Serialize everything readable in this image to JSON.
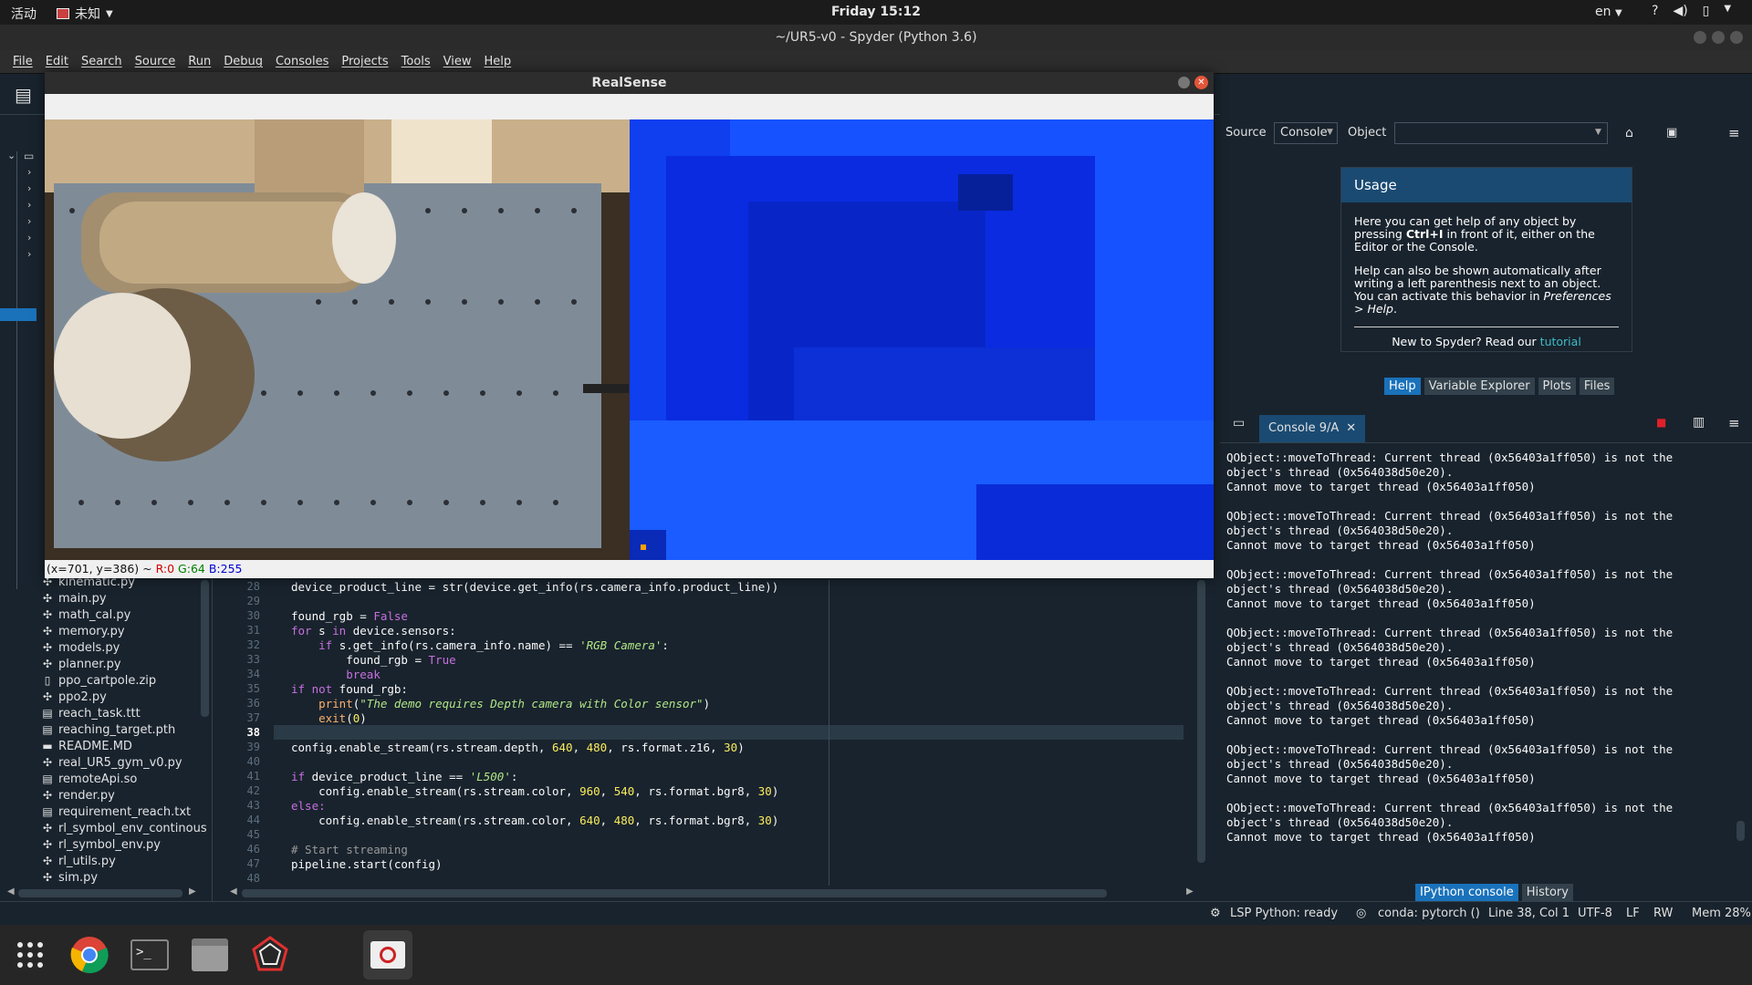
{
  "topbar": {
    "activities": "活动",
    "app_menu": "未知",
    "clock": "Friday 15:12",
    "lang": "en"
  },
  "window": {
    "title": "~/UR5-v0 - Spyder (Python 3.6)"
  },
  "menubar": [
    "File",
    "Edit",
    "Search",
    "Source",
    "Run",
    "Debug",
    "Consoles",
    "Projects",
    "Tools",
    "View",
    "Help"
  ],
  "realsense": {
    "title": "RealSense",
    "status_prefix": "(x=701, y=386) ~ ",
    "status_r": "R:0",
    "status_g": "G:64",
    "status_b": "B:255",
    "status_colors": {
      "r": "#d00000",
      "g": "#008000",
      "b": "#0000d0"
    }
  },
  "files": [
    "kinematic.py",
    "main.py",
    "math_cal.py",
    "memory.py",
    "models.py",
    "planner.py",
    "ppo_cartpole.zip",
    "ppo2.py",
    "reach_task.ttt",
    "reaching_target.pth",
    "README.MD",
    "real_UR5_gym_v0.py",
    "remoteApi.so",
    "render.py",
    "requirement_reach.txt",
    "rl_symbol_env_continous",
    "rl_symbol_env.py",
    "rl_utils.py",
    "sim.py"
  ],
  "editor": {
    "line_numbers": [
      "28",
      "29",
      "30",
      "31",
      "32",
      "33",
      "34",
      "35",
      "36",
      "37",
      "38",
      "39",
      "40",
      "41",
      "42",
      "43",
      "44",
      "45",
      "46",
      "47",
      "48"
    ],
    "current_line": "38"
  },
  "help": {
    "source_label": "Source",
    "source_value": "Console",
    "object_label": "Object",
    "usage_title": "Usage",
    "p1_a": "Here you can get help of any object by pressing ",
    "p1_b": "Ctrl+I",
    "p1_c": " in front of it, either on the Editor or the Console.",
    "p2_a": "Help can also be shown automatically after writing a left parenthesis next to an object. You can activate this behavior in ",
    "p2_b": "Preferences > Help",
    "p2_c": ".",
    "footer_a": "New to Spyder? Read our ",
    "footer_link": "tutorial",
    "tabs": [
      "Help",
      "Variable Explorer",
      "Plots",
      "Files"
    ]
  },
  "console": {
    "tab": "Console 9/A",
    "bottom_tabs": [
      "IPython console",
      "History"
    ],
    "lines": [
      "QObject::moveToThread: Current thread (0x56403a1ff050) is not the",
      "object's thread (0x564038d50e20).",
      "Cannot move to target thread (0x56403a1ff050)",
      "",
      "QObject::moveToThread: Current thread (0x56403a1ff050) is not the",
      "object's thread (0x564038d50e20).",
      "Cannot move to target thread (0x56403a1ff050)",
      "",
      "QObject::moveToThread: Current thread (0x56403a1ff050) is not the",
      "object's thread (0x564038d50e20).",
      "Cannot move to target thread (0x56403a1ff050)",
      "",
      "QObject::moveToThread: Current thread (0x56403a1ff050) is not the",
      "object's thread (0x564038d50e20).",
      "Cannot move to target thread (0x56403a1ff050)",
      "",
      "QObject::moveToThread: Current thread (0x56403a1ff050) is not the",
      "object's thread (0x564038d50e20).",
      "Cannot move to target thread (0x56403a1ff050)",
      "",
      "QObject::moveToThread: Current thread (0x56403a1ff050) is not the",
      "object's thread (0x564038d50e20).",
      "Cannot move to target thread (0x56403a1ff050)",
      "",
      "QObject::moveToThread: Current thread (0x56403a1ff050) is not the",
      "object's thread (0x564038d50e20).",
      "Cannot move to target thread (0x56403a1ff050)"
    ]
  },
  "status": {
    "lsp": "LSP Python: ready",
    "conda": "conda: pytorch ()",
    "position": "Line 38, Col 1",
    "encoding": "UTF-8",
    "eol": "LF",
    "rw": "RW",
    "mem": "Mem 28%"
  }
}
